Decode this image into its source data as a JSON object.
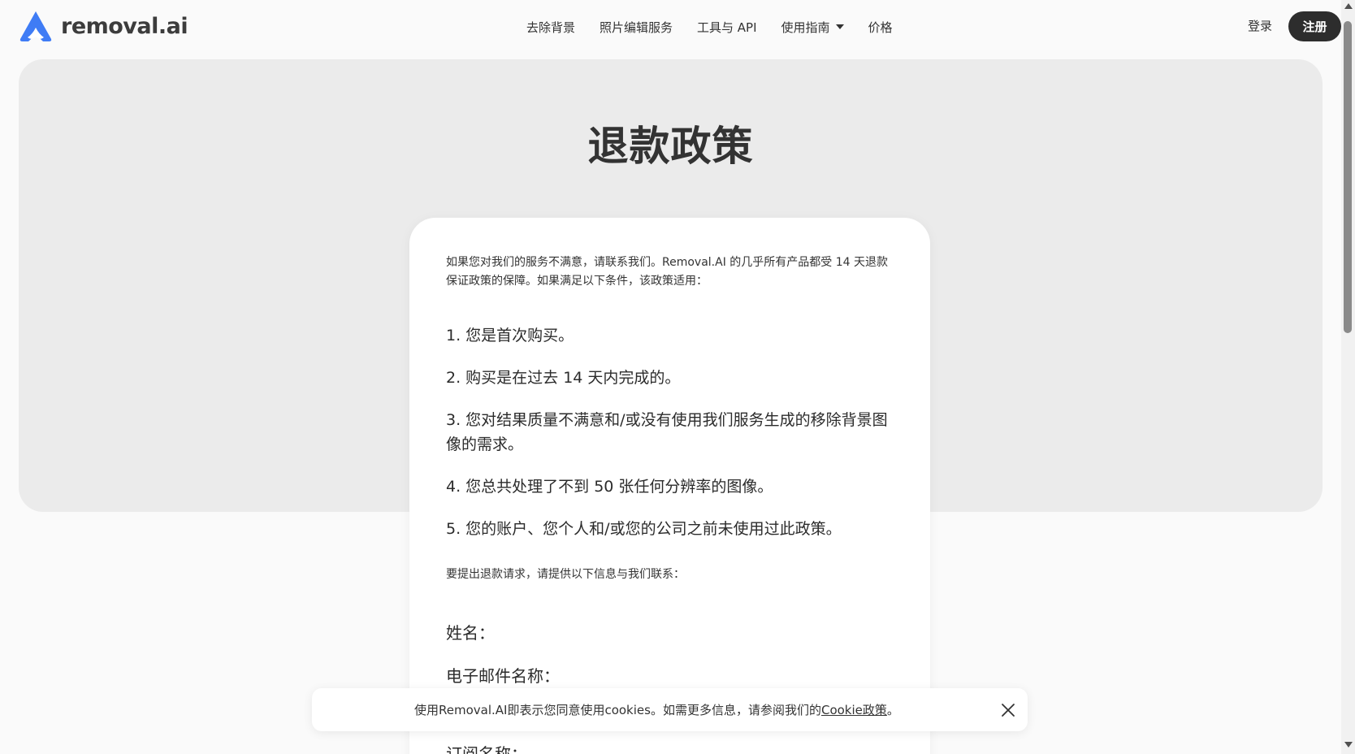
{
  "header": {
    "logo_text": "removal.ai",
    "logo_color": "#3f7cf5",
    "nav": [
      {
        "label": "去除背景"
      },
      {
        "label": "照片编辑服务"
      },
      {
        "label": "工具与 API"
      },
      {
        "label": "使用指南"
      },
      {
        "label": "价格"
      }
    ],
    "login_label": "登录",
    "signup_label": "注册"
  },
  "hero": {
    "title": "退款政策"
  },
  "card": {
    "intro": "如果您对我们的服务不满意，请联系我们。Removal.AI 的几乎所有产品都受 14 天退款保证政策的保障。如果满足以下条件，该政策适用：",
    "conditions": [
      "1. 您是首次购买。",
      "2. 购买是在过去 14 天内完成的。",
      "3. 您对结果质量不满意和/或没有使用我们服务生成的移除背景图像的需求。",
      "4. 您总共处理了不到 50 张任何分辨率的图像。",
      "5. 您的账户、您个人和/或您的公司之前未使用过此政策。"
    ],
    "contact_note": "要提出退款请求，请提供以下信息与我们联系：",
    "fields": [
      "姓名：",
      "电子邮件名称：",
      "订阅名称："
    ]
  },
  "cookie_banner": {
    "text": "使用Removal.AI即表示您同意使用cookies。如需更多信息，请参阅我们的",
    "link_label": "Cookie政策",
    "suffix": "。"
  }
}
